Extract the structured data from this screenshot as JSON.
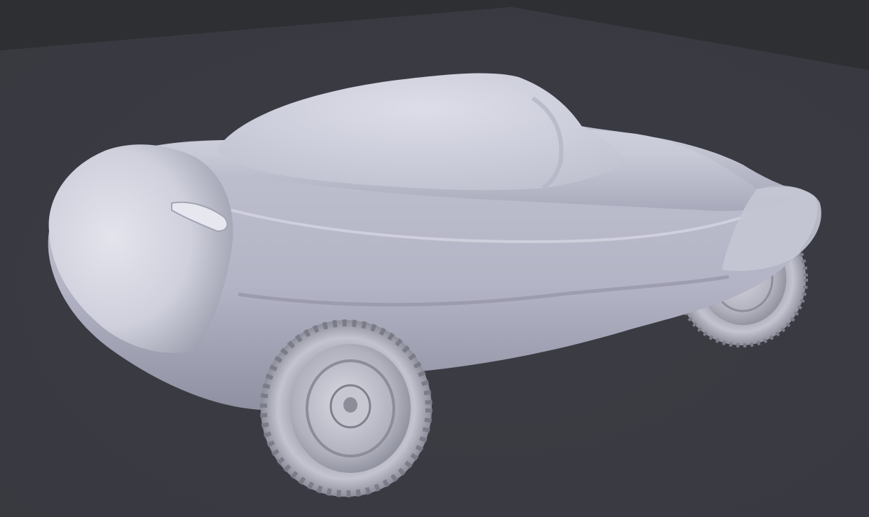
{
  "scene": {
    "subject": "car-clay-model",
    "colors": {
      "background": "#393a40",
      "floor": "#3a3b41",
      "body": "#c7c8d6",
      "body_shadow": "#9a9cae",
      "tire": "#b9bac4",
      "hub": "#a9aab4"
    }
  }
}
